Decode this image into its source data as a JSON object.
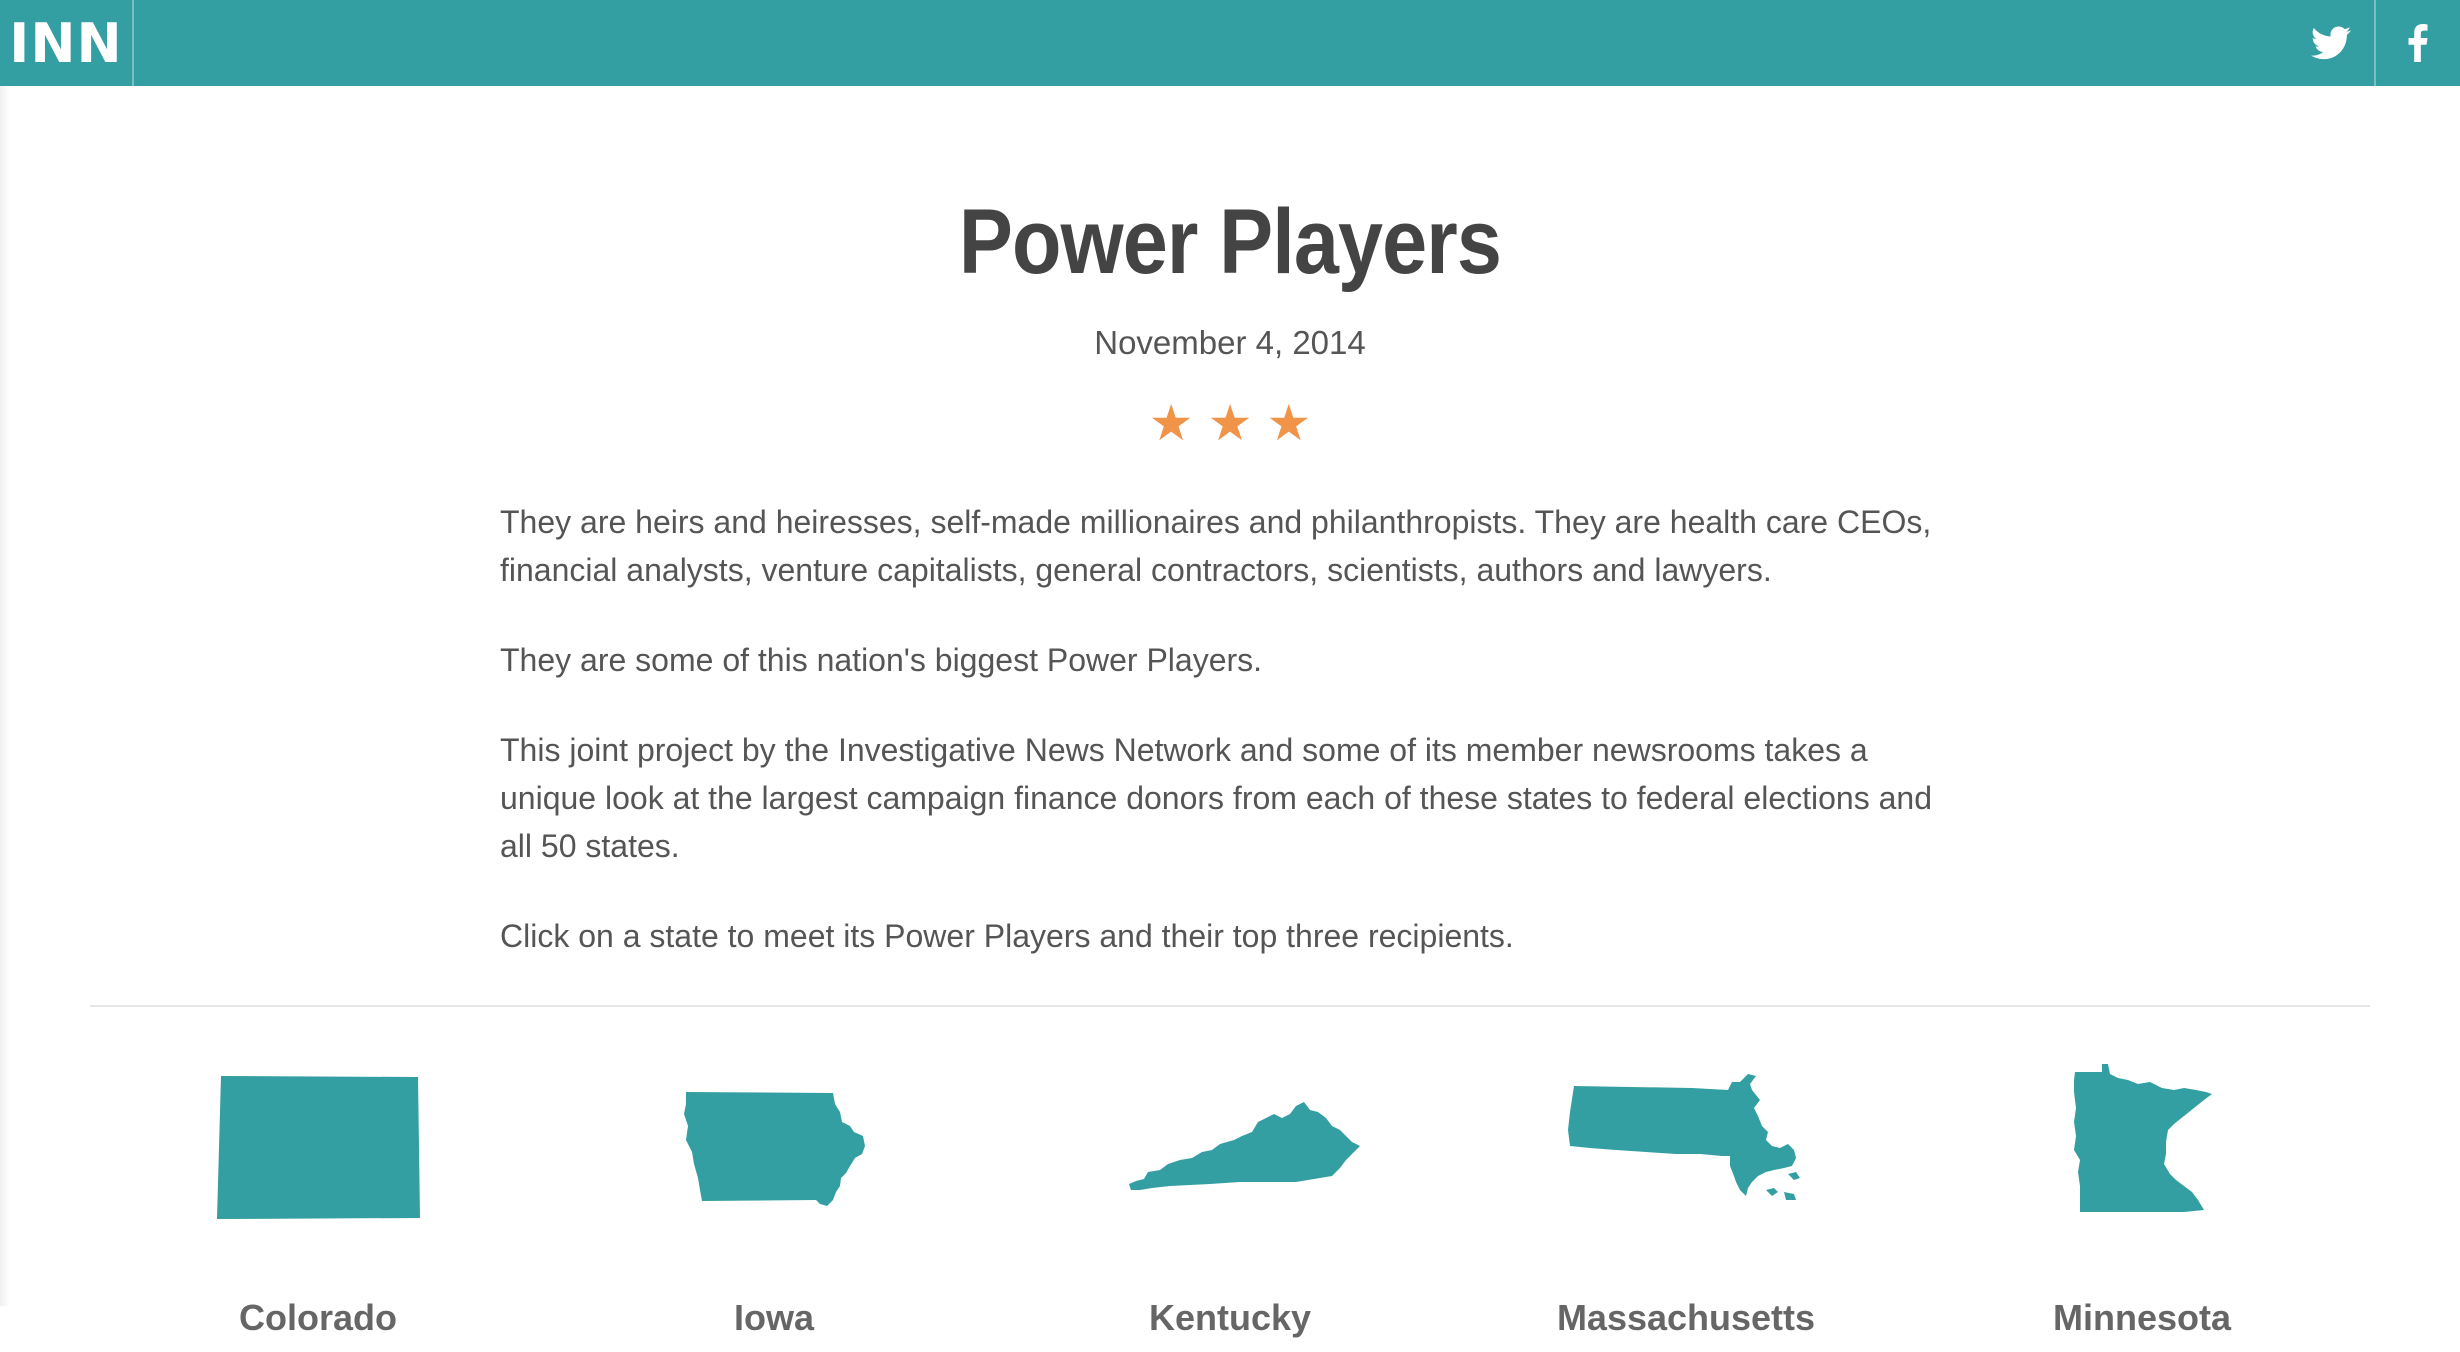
{
  "header": {
    "logo": "INN",
    "brand_color": "#349fa2",
    "social": [
      {
        "name": "twitter",
        "icon": "twitter-icon"
      },
      {
        "name": "facebook",
        "icon": "facebook-icon"
      }
    ]
  },
  "article": {
    "title": "Power Players",
    "date": "November 4, 2014",
    "rating": 3,
    "star_color": "#f0944a",
    "paragraphs": [
      "They are heirs and heiresses, self-made millionaires and philanthropists. They are health care CEOs, financial analysts, venture capitalists, general contractors, scientists, authors and lawyers.",
      "They are some of this nation's biggest Power Players.",
      "This joint project by the Investigative News Network and some of its member newsrooms takes a unique look at the largest campaign finance donors from each of these states to federal elections and all 50 states.",
      "Click on a state to meet its Power Players and their top three recipients."
    ]
  },
  "states": [
    {
      "name": "Colorado",
      "icon": "colorado-map-icon"
    },
    {
      "name": "Iowa",
      "icon": "iowa-map-icon"
    },
    {
      "name": "Kentucky",
      "icon": "kentucky-map-icon"
    },
    {
      "name": "Massachusetts",
      "icon": "massachusetts-map-icon"
    },
    {
      "name": "Minnesota",
      "icon": "minnesota-map-icon"
    }
  ]
}
